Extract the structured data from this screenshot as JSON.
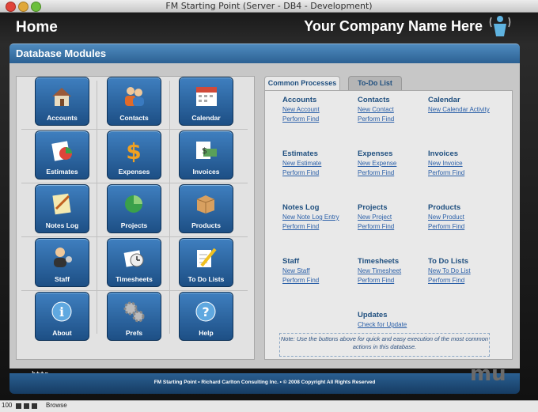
{
  "window": {
    "title": "FM Starting Point (Server - DB4 - Development)"
  },
  "header": {
    "home_label": "Home",
    "company_name": "Your Company Name Here"
  },
  "modules_header": "Database Modules",
  "modules": [
    {
      "label": "Accounts",
      "icon": "house-icon"
    },
    {
      "label": "Contacts",
      "icon": "people-icon"
    },
    {
      "label": "Calendar",
      "icon": "calendar-icon"
    },
    {
      "label": "Estimates",
      "icon": "estimate-chart-icon"
    },
    {
      "label": "Expenses",
      "icon": "dollar-icon"
    },
    {
      "label": "Invoices",
      "icon": "invoice-money-icon"
    },
    {
      "label": "Notes Log",
      "icon": "notepad-icon"
    },
    {
      "label": "Projects",
      "icon": "pie-chart-icon"
    },
    {
      "label": "Products",
      "icon": "box-icon"
    },
    {
      "label": "Staff",
      "icon": "staff-person-icon"
    },
    {
      "label": "Timesheets",
      "icon": "clock-icon"
    },
    {
      "label": "To Do Lists",
      "icon": "checklist-pencil-icon"
    },
    {
      "label": "About",
      "icon": "info-icon"
    },
    {
      "label": "Prefs",
      "icon": "gears-icon"
    },
    {
      "label": "Help",
      "icon": "help-icon"
    }
  ],
  "tabs": [
    {
      "label": "Common Processes",
      "active": true
    },
    {
      "label": "To-Do List",
      "active": false
    }
  ],
  "processes": [
    {
      "title": "Accounts",
      "links": [
        "New Account",
        "Perform Find"
      ]
    },
    {
      "title": "Contacts",
      "links": [
        "New Contact",
        "Perform Find"
      ]
    },
    {
      "title": "Calendar",
      "links": [
        "New Calendar Activity"
      ]
    },
    {
      "title": "Estimates",
      "links": [
        "New Estimate",
        "Perform Find"
      ]
    },
    {
      "title": "Expenses",
      "links": [
        "New Expense",
        "Perform Find"
      ]
    },
    {
      "title": "Invoices",
      "links": [
        "New Invoice",
        "Perform Find"
      ]
    },
    {
      "title": "Notes Log",
      "links": [
        "New Note Log Entry",
        "Perform Find"
      ]
    },
    {
      "title": "Projects",
      "links": [
        "New Project",
        "Perform Find"
      ]
    },
    {
      "title": "Products",
      "links": [
        "New Product",
        "Perform Find"
      ]
    },
    {
      "title": "Staff",
      "links": [
        "New Staff",
        "Perform Find"
      ]
    },
    {
      "title": "Timesheets",
      "links": [
        "New Timesheet",
        "Perform Find"
      ]
    },
    {
      "title": "To Do Lists",
      "links": [
        "New To Do List",
        "Perform Find"
      ]
    },
    {
      "title": "Updates",
      "links": [
        "Check for Update"
      ]
    }
  ],
  "note": "Note: Use the buttons above for quick and easy execution of the most common actions in this database.",
  "footer": "FM Starting Point   •   Richard Carlton Consulting Inc.   •   © 2008 Copyright All Rights Reserved",
  "http_text": "http",
  "watermark": "mu",
  "statusbar": {
    "zoom": "100",
    "mode": "Browse"
  }
}
